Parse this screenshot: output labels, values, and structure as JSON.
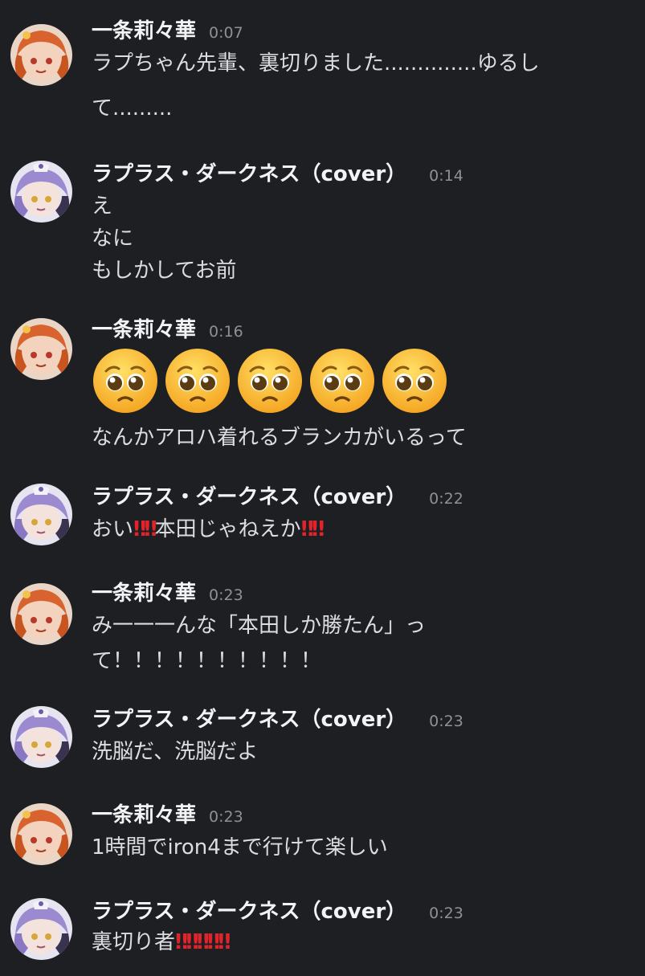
{
  "users": {
    "ichijo": {
      "name": "一条莉々華",
      "avatar_icon": "orange-hair-girl-avatar-icon",
      "hair_color": "#d8632e"
    },
    "laplus": {
      "name": "ラプラス・ダークネス（cover）",
      "avatar_icon": "purple-hair-girl-avatar-icon",
      "hair_color": "#9b8ad0"
    }
  },
  "messages": [
    {
      "author": "一条莉々華",
      "time": "0:07",
      "lines": [
        "ラプちゃん先輩、裏切りました..............ゆるし",
        "て........."
      ]
    },
    {
      "author": "ラプラス・ダークネス（cover）",
      "time": "0:14",
      "lines": [
        "え",
        "なに",
        "もしかしてお前"
      ]
    },
    {
      "author": "一条莉々華",
      "time": "0:16",
      "emoji_name": "pleading-face-emoji",
      "emoji_count": 5,
      "lines": [
        "なんかアロハ着れるブランカがいるって"
      ]
    },
    {
      "author": "ラプラス・ダークネス（cover）",
      "time": "0:22",
      "segments": [
        "おい",
        "‼‼",
        "本田じゃねえか",
        "‼‼"
      ]
    },
    {
      "author": "一条莉々華",
      "time": "0:23",
      "lines": [
        "み一一一んな「本田しか勝たん」っ",
        "て！！！！！！！！！！"
      ]
    },
    {
      "author": "ラプラス・ダークネス（cover）",
      "time": "0:23",
      "lines": [
        "洗脳だ、洗脳だよ"
      ]
    },
    {
      "author": "一条莉々華",
      "time": "0:23",
      "lines": [
        "1時間でiron4まで行けて楽しい"
      ]
    },
    {
      "author": "ラプラス・ダークネス（cover）",
      "time": "0:23",
      "segments": [
        "裏切り者",
        "‼‼‼‼‼"
      ]
    }
  ],
  "colors": {
    "background": "#1e1f23",
    "username": "#f2f3f5",
    "text": "#dcdde1",
    "timestamp": "#8e9097",
    "exclamation": "#e0242b"
  }
}
